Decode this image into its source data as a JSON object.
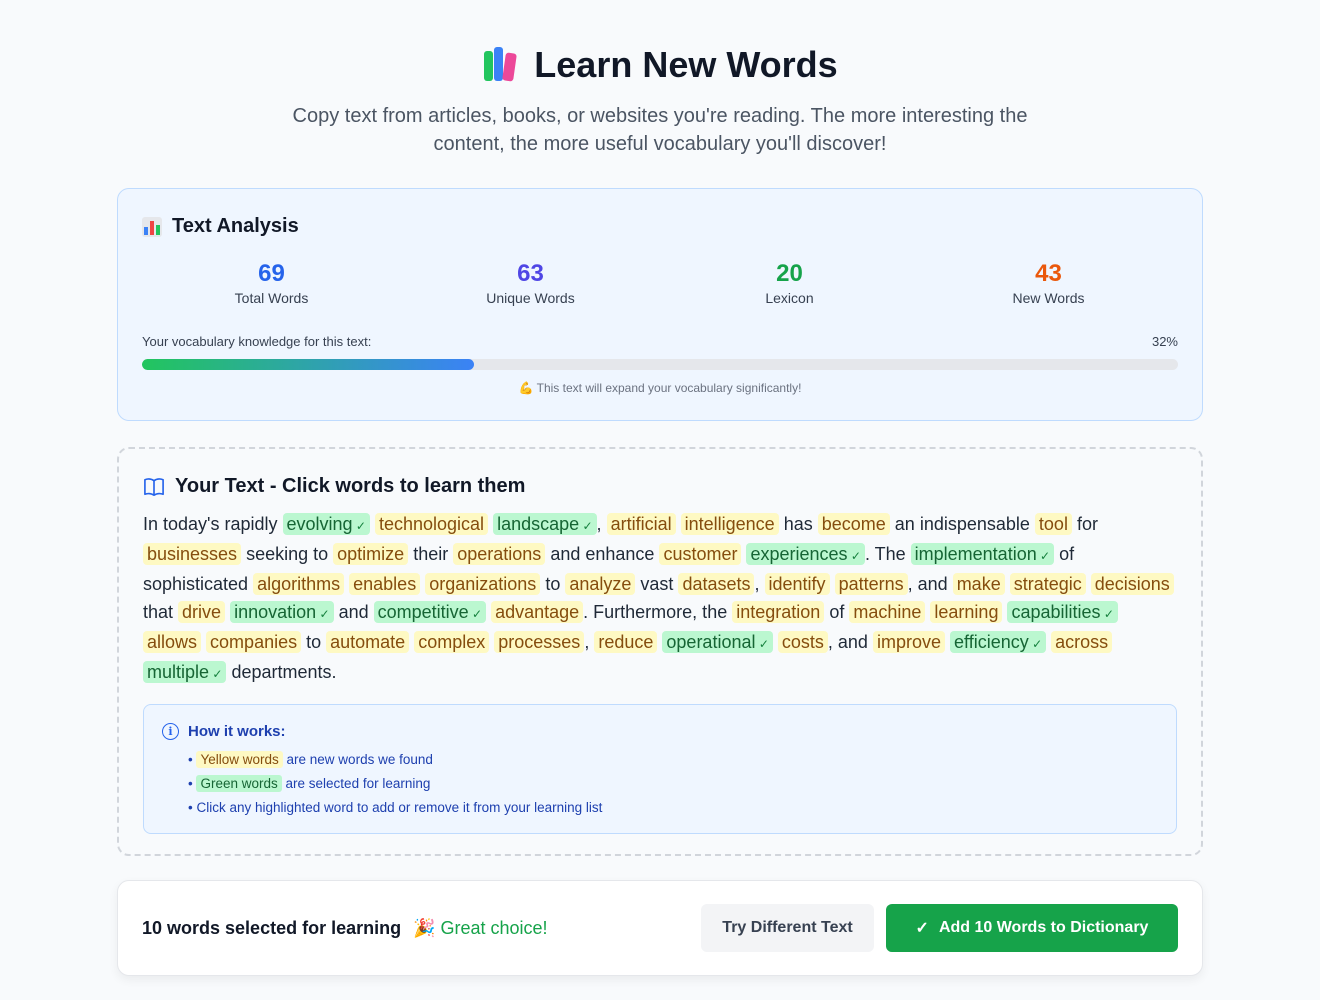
{
  "header": {
    "title": "Learn New Words",
    "subtitle": "Copy text from articles, books, or websites you're reading. The more interesting the content, the more useful vocabulary you'll discover!"
  },
  "analysis": {
    "title": "Text Analysis",
    "stats": [
      {
        "value": "69",
        "label": "Total Words",
        "color": "#2563eb"
      },
      {
        "value": "63",
        "label": "Unique Words",
        "color": "#4f46e5"
      },
      {
        "value": "20",
        "label": "Lexicon",
        "color": "#16a34a"
      },
      {
        "value": "43",
        "label": "New Words",
        "color": "#ea580c"
      }
    ],
    "knowledge_label": "Your vocabulary knowledge for this text:",
    "knowledge_percent_text": "32%",
    "knowledge_fraction": 0.32,
    "note": "💪 This text will expand your vocabulary significantly!"
  },
  "text_section": {
    "title": "Your Text - Click words to learn them",
    "tokens": [
      {
        "t": "In today's rapidly"
      },
      {
        "w": "evolving",
        "s": "selected"
      },
      {
        "w": "technological",
        "s": "new"
      },
      {
        "w": "landscape",
        "s": "selected"
      },
      {
        "t": ","
      },
      {
        "w": "artificial",
        "s": "new"
      },
      {
        "w": "intelligence",
        "s": "new"
      },
      {
        "t": "has"
      },
      {
        "w": "become",
        "s": "new"
      },
      {
        "t": "an indispensable"
      },
      {
        "w": "tool",
        "s": "new"
      },
      {
        "t": "for"
      },
      {
        "w": "businesses",
        "s": "new"
      },
      {
        "t": "seeking to"
      },
      {
        "w": "optimize",
        "s": "new"
      },
      {
        "t": "their"
      },
      {
        "w": "operations",
        "s": "new"
      },
      {
        "t": "and enhance"
      },
      {
        "w": "customer",
        "s": "new"
      },
      {
        "w": "experiences",
        "s": "selected"
      },
      {
        "t": ". The"
      },
      {
        "w": "implementation",
        "s": "selected"
      },
      {
        "t": "of sophisticated"
      },
      {
        "w": "algorithms",
        "s": "new"
      },
      {
        "w": "enables",
        "s": "new"
      },
      {
        "w": "organizations",
        "s": "new"
      },
      {
        "t": "to"
      },
      {
        "w": "analyze",
        "s": "new"
      },
      {
        "t": "vast"
      },
      {
        "w": "datasets",
        "s": "new"
      },
      {
        "t": ","
      },
      {
        "w": "identify",
        "s": "new"
      },
      {
        "w": "patterns",
        "s": "new"
      },
      {
        "t": ", and"
      },
      {
        "w": "make",
        "s": "new"
      },
      {
        "w": "strategic",
        "s": "new"
      },
      {
        "w": "decisions",
        "s": "new"
      },
      {
        "t": "that"
      },
      {
        "w": "drive",
        "s": "new"
      },
      {
        "w": "innovation",
        "s": "selected"
      },
      {
        "t": "and"
      },
      {
        "w": "competitive",
        "s": "selected"
      },
      {
        "w": "advantage",
        "s": "new"
      },
      {
        "t": ". Furthermore, the"
      },
      {
        "w": "integration",
        "s": "new"
      },
      {
        "t": "of"
      },
      {
        "w": "machine",
        "s": "new"
      },
      {
        "w": "learning",
        "s": "new"
      },
      {
        "w": "capabilities",
        "s": "selected"
      },
      {
        "w": "allows",
        "s": "new"
      },
      {
        "w": "companies",
        "s": "new"
      },
      {
        "t": "to"
      },
      {
        "w": "automate",
        "s": "new"
      },
      {
        "w": "complex",
        "s": "new"
      },
      {
        "w": "processes",
        "s": "new"
      },
      {
        "t": ","
      },
      {
        "w": "reduce",
        "s": "new"
      },
      {
        "w": "operational",
        "s": "selected"
      },
      {
        "w": "costs",
        "s": "new"
      },
      {
        "t": ", and"
      },
      {
        "w": "improve",
        "s": "new"
      },
      {
        "w": "efficiency",
        "s": "selected"
      },
      {
        "w": "across",
        "s": "new"
      },
      {
        "w": "multiple",
        "s": "selected"
      },
      {
        "t": "departments."
      }
    ],
    "how_it_works": {
      "title": "How it works:",
      "yellow_tag": "Yellow words",
      "yellow_rest": " are new words we found",
      "green_tag": "Green words",
      "green_rest": " are selected for learning",
      "click_item": "Click any highlighted word to add or remove it from your learning list"
    }
  },
  "footer": {
    "selected_text": "10 words selected for learning",
    "great_choice": "🎉 Great choice!",
    "try_button": "Try Different Text",
    "add_button": "Add 10 Words to Dictionary"
  }
}
